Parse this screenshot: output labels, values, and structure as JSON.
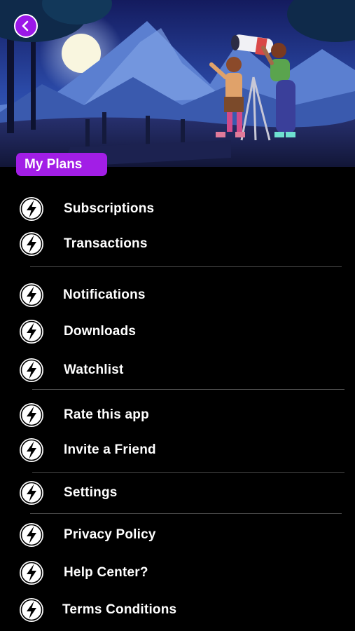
{
  "header": {
    "back_icon": "chevron-left-icon",
    "plans_label": "My Plans",
    "accent_color": "#a21ee6"
  },
  "menu": {
    "item_icon": "lightning-bolt-icon",
    "items": [
      {
        "label": "Subscriptions"
      },
      {
        "label": "Transactions"
      },
      {
        "label": "Notifications"
      },
      {
        "label": "Downloads"
      },
      {
        "label": "Watchlist"
      },
      {
        "label": "Rate this app"
      },
      {
        "label": "Invite a Friend"
      },
      {
        "label": "Settings"
      },
      {
        "label": "Privacy Policy"
      },
      {
        "label": "Help Center?"
      },
      {
        "label": "Terms Conditions"
      }
    ]
  }
}
